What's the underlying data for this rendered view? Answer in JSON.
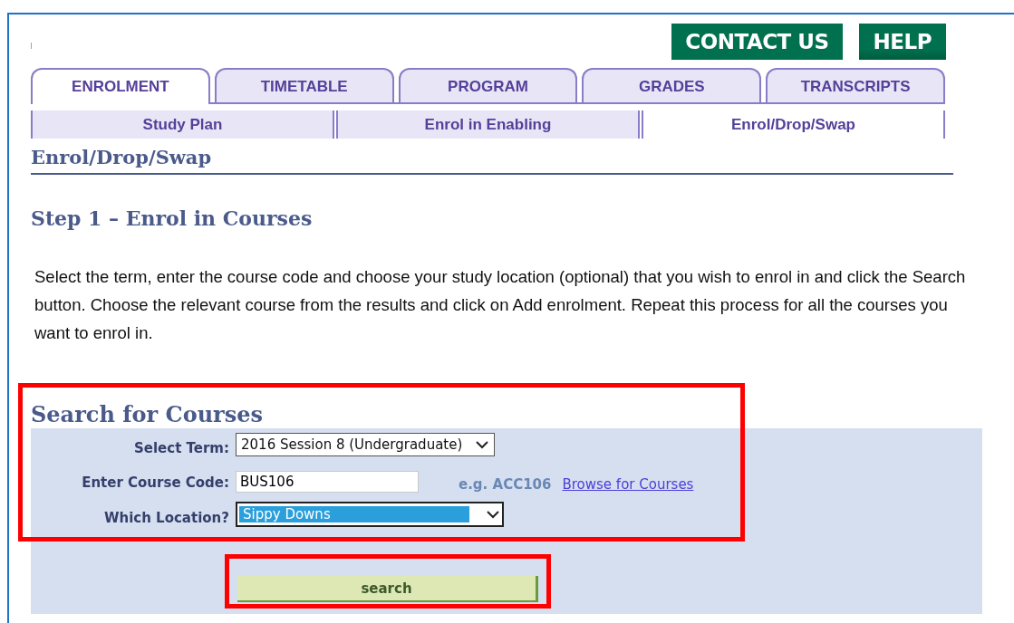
{
  "header_buttons": [
    "CONTACT US",
    "HELP"
  ],
  "tabs": [
    {
      "label": "ENROLMENT",
      "selected": true
    },
    {
      "label": "TIMETABLE",
      "selected": false
    },
    {
      "label": "PROGRAM",
      "selected": false
    },
    {
      "label": "GRADES",
      "selected": false
    },
    {
      "label": "TRANSCRIPTS",
      "selected": false
    }
  ],
  "subtabs": [
    {
      "label": "Study Plan",
      "selected": false
    },
    {
      "label": "Enrol in Enabling",
      "selected": false
    },
    {
      "label": "Enrol/Drop/Swap",
      "selected": true
    }
  ],
  "page_title": "Enrol/Drop/Swap",
  "step_heading": "Step 1 – Enrol in Courses",
  "instructions": "Select the term, enter the course code and choose your study location (optional) that you wish to enrol in and click the Search button. Choose the relevant course from the results and click on Add enrolment. Repeat this process for all the courses you want to enrol in.",
  "search_form": {
    "heading": "Search for Courses",
    "highlighted": true,
    "term": {
      "label": "Select Term:",
      "value": "2016 Session 8 (Undergraduate)"
    },
    "course_code": {
      "label": "Enter Course Code:",
      "value": "BUS106",
      "hint": "e.g. ACC106",
      "link": "Browse for Courses"
    },
    "location": {
      "label": "Which Location?",
      "value": "Sippy Downs",
      "focused": true
    },
    "search_button": {
      "label": "search",
      "highlighted": true
    }
  }
}
